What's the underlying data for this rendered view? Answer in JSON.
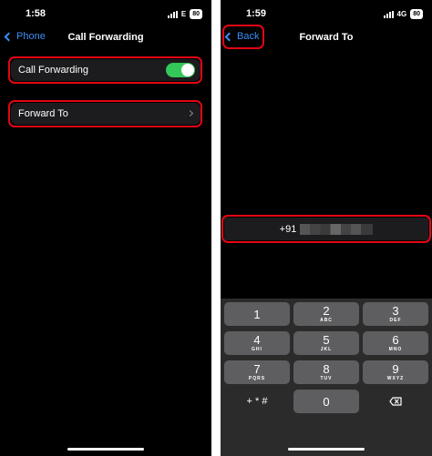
{
  "left_screen": {
    "status": {
      "time": "1:58",
      "network": "E",
      "battery": "80"
    },
    "nav": {
      "back_label": "Phone",
      "title": "Call Forwarding"
    },
    "call_forwarding": {
      "label": "Call Forwarding",
      "enabled": true
    },
    "forward_to": {
      "label": "Forward To"
    }
  },
  "right_screen": {
    "status": {
      "time": "1:59",
      "network": "4G",
      "battery": "80"
    },
    "nav": {
      "back_label": "Back",
      "title": "Forward To"
    },
    "number_field": {
      "prefix": "+91"
    },
    "keypad": {
      "keys": [
        {
          "digit": "1",
          "letters": ""
        },
        {
          "digit": "2",
          "letters": "ABC"
        },
        {
          "digit": "3",
          "letters": "DEF"
        },
        {
          "digit": "4",
          "letters": "GHI"
        },
        {
          "digit": "5",
          "letters": "JKL"
        },
        {
          "digit": "6",
          "letters": "MNO"
        },
        {
          "digit": "7",
          "letters": "PQRS"
        },
        {
          "digit": "8",
          "letters": "TUV"
        },
        {
          "digit": "9",
          "letters": "WXYZ"
        }
      ],
      "symbols_label": "+ * #",
      "zero": "0"
    }
  },
  "colors": {
    "accent": "#3a8ef6",
    "toggle_on": "#34c759",
    "highlight": "#e30613"
  }
}
